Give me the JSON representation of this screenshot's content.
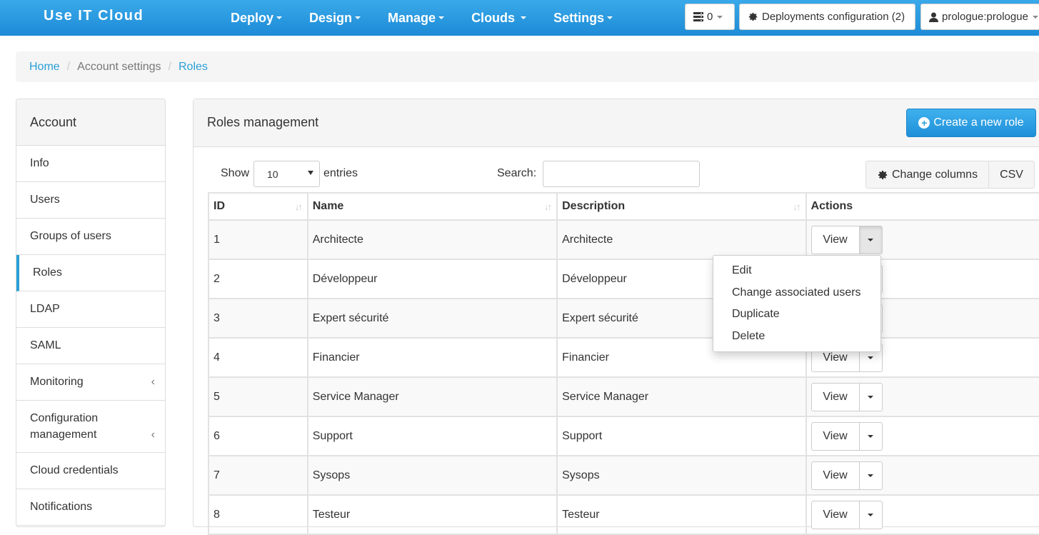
{
  "navbar": {
    "brand": "Use IT Cloud",
    "menu": [
      {
        "label": "Deploy"
      },
      {
        "label": "Design"
      },
      {
        "label": "Manage"
      },
      {
        "label": "Clouds"
      },
      {
        "label": "Settings"
      }
    ],
    "queue_count": "0",
    "deployments_config": "Deployments configuration (2)",
    "user": "prologue:prologue",
    "bg_color": "#1d8bd6"
  },
  "breadcrumb": {
    "home": "Home",
    "account_settings": "Account settings",
    "roles": "Roles"
  },
  "sidebar": {
    "header": "Account",
    "items": [
      {
        "label": "Info"
      },
      {
        "label": "Users"
      },
      {
        "label": "Groups of users"
      },
      {
        "label": "Roles"
      },
      {
        "label": "LDAP"
      },
      {
        "label": "SAML"
      },
      {
        "label": "Monitoring"
      },
      {
        "label": "Configuration management"
      },
      {
        "label": "Cloud credentials"
      },
      {
        "label": "Notifications"
      }
    ],
    "active": "Roles",
    "accent_color": "#2a9fd6"
  },
  "panel": {
    "title": "Roles management",
    "create_button": "Create a new role",
    "show_label": "Show",
    "entries_value": "10",
    "entries_label": "entries",
    "search_label": "Search:",
    "search_value": "",
    "change_columns": "Change columns",
    "csv": "CSV"
  },
  "table": {
    "headers": {
      "id": "ID",
      "name": "Name",
      "description": "Description",
      "actions": "Actions"
    },
    "view_label": "View",
    "rows": [
      {
        "id": "1",
        "name": "Architecte",
        "description": "Architecte"
      },
      {
        "id": "2",
        "name": "Développeur",
        "description": "Développeur"
      },
      {
        "id": "3",
        "name": "Expert sécurité",
        "description": "Expert sécurité"
      },
      {
        "id": "4",
        "name": "Financier",
        "description": "Financier"
      },
      {
        "id": "5",
        "name": "Service Manager",
        "description": "Service Manager"
      },
      {
        "id": "6",
        "name": "Support",
        "description": "Support"
      },
      {
        "id": "7",
        "name": "Sysops",
        "description": "Sysops"
      },
      {
        "id": "8",
        "name": "Testeur",
        "description": "Testeur"
      }
    ]
  },
  "dropdown": {
    "items": [
      {
        "label": "Edit"
      },
      {
        "label": "Change associated users"
      },
      {
        "label": "Duplicate"
      },
      {
        "label": "Delete"
      }
    ]
  }
}
